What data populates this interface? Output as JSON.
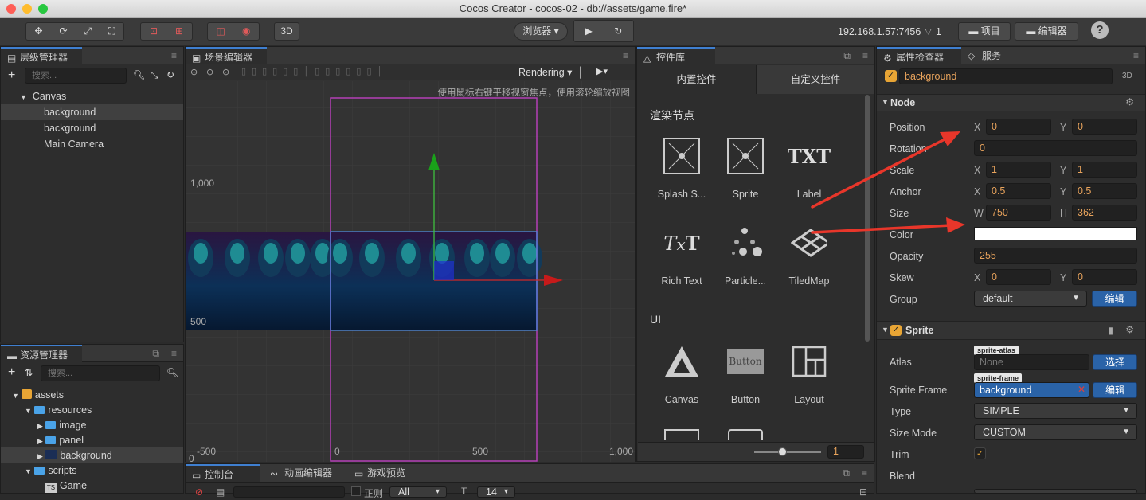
{
  "window": {
    "title": "Cocos Creator - cocos-02 - db://assets/game.fire*"
  },
  "toolbar": {
    "mode_3d": "3D",
    "browser": "浏览器",
    "ip": "192.168.1.57:7456",
    "connections": "1",
    "project": "项目",
    "editor": "编辑器",
    "help": "?"
  },
  "hierarchy": {
    "title": "层级管理器",
    "search_placeholder": "搜索...",
    "nodes": [
      "Canvas",
      "background",
      "background",
      "Main Camera"
    ]
  },
  "assets": {
    "title": "资源管理器",
    "search_placeholder": "搜索...",
    "items": [
      "assets",
      "resources",
      "image",
      "panel",
      "background",
      "scripts",
      "Game"
    ]
  },
  "scene": {
    "title": "场景编辑器",
    "rendering": "Rendering",
    "hint": "使用鼠标右键平移视窗焦点，使用滚轮缩放视图",
    "y_labels": [
      "1,000",
      "500",
      "0"
    ],
    "x_labels": [
      "-500",
      "0",
      "500",
      "1,000"
    ]
  },
  "bottom": {
    "console": "控制台",
    "animation": "动画编辑器",
    "preview": "游戏预览",
    "regex": "正则",
    "filter": "All",
    "font_size": "14"
  },
  "widgets": {
    "title": "控件库",
    "tab_builtin": "内置控件",
    "tab_custom": "自定义控件",
    "section_render": "渲染节点",
    "section_ui": "UI",
    "render_items": [
      "Splash S...",
      "Sprite",
      "Label",
      "Rich Text",
      "Particle...",
      "TiledMap"
    ],
    "ui_items": [
      "Canvas",
      "Button",
      "Layout"
    ],
    "button_icon_text": "Button",
    "label_icon_text": "TXT",
    "zoom_value": "1"
  },
  "inspector": {
    "title": "属性检查器",
    "service_tab": "服务",
    "node_name": "background",
    "mode_3d": "3D",
    "node_section": "Node",
    "position_label": "Position",
    "position_x": "0",
    "position_y": "0",
    "rotation_label": "Rotation",
    "rotation": "0",
    "scale_label": "Scale",
    "scale_x": "1",
    "scale_y": "1",
    "anchor_label": "Anchor",
    "anchor_x": "0.5",
    "anchor_y": "0.5",
    "size_label": "Size",
    "size_w": "750",
    "size_h": "362",
    "color_label": "Color",
    "color_value": "#ffffff",
    "opacity_label": "Opacity",
    "opacity": "255",
    "skew_label": "Skew",
    "skew_x": "0",
    "skew_y": "0",
    "group_label": "Group",
    "group": "default",
    "edit_btn": "编辑",
    "sprite_section": "Sprite",
    "atlas_label": "Atlas",
    "atlas_tag": "sprite-atlas",
    "atlas_value": "None",
    "select_btn": "选择",
    "frame_label": "Sprite Frame",
    "frame_tag": "sprite-frame",
    "frame_value": "background",
    "type_label": "Type",
    "type_value": "SIMPLE",
    "sizemode_label": "Size Mode",
    "sizemode_value": "CUSTOM",
    "trim_label": "Trim",
    "blend_label": "Blend",
    "x": "X",
    "y": "Y",
    "w": "W",
    "h": "H"
  },
  "colors": {
    "accent": "#3f7fd0",
    "arrow": "#e8362a",
    "value": "#e8a35c"
  }
}
